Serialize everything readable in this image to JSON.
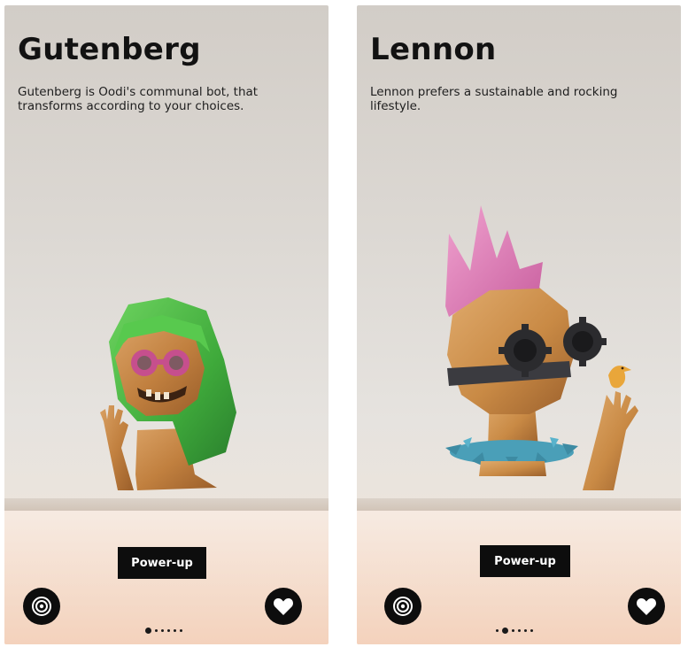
{
  "screens": [
    {
      "title": "Gutenberg",
      "description": "Gutenberg is Oodi's communal bot, that transforms according to your choices.",
      "power_up_label": "Power-up",
      "settings_icon": "settings-icon",
      "favorite_icon": "heart-icon",
      "page_count": 6,
      "active_page": 1
    },
    {
      "title": "Lennon",
      "description": "Lennon prefers a sustainable and rocking lifestyle.",
      "power_up_label": "Power-up",
      "settings_icon": "settings-icon",
      "favorite_icon": "heart-icon",
      "page_count": 6,
      "active_page": 2
    }
  ],
  "colors": {
    "button_bg": "#0d0d0d",
    "button_text": "#ffffff",
    "title_text": "#121212",
    "hood_green": "#4fbf4a",
    "goggle_pink": "#c74f8f",
    "mohawk_pink": "#e58ac0",
    "collar_blue": "#4a9fb8",
    "wood": "#c98a45",
    "bird_yellow": "#e9a63a"
  }
}
